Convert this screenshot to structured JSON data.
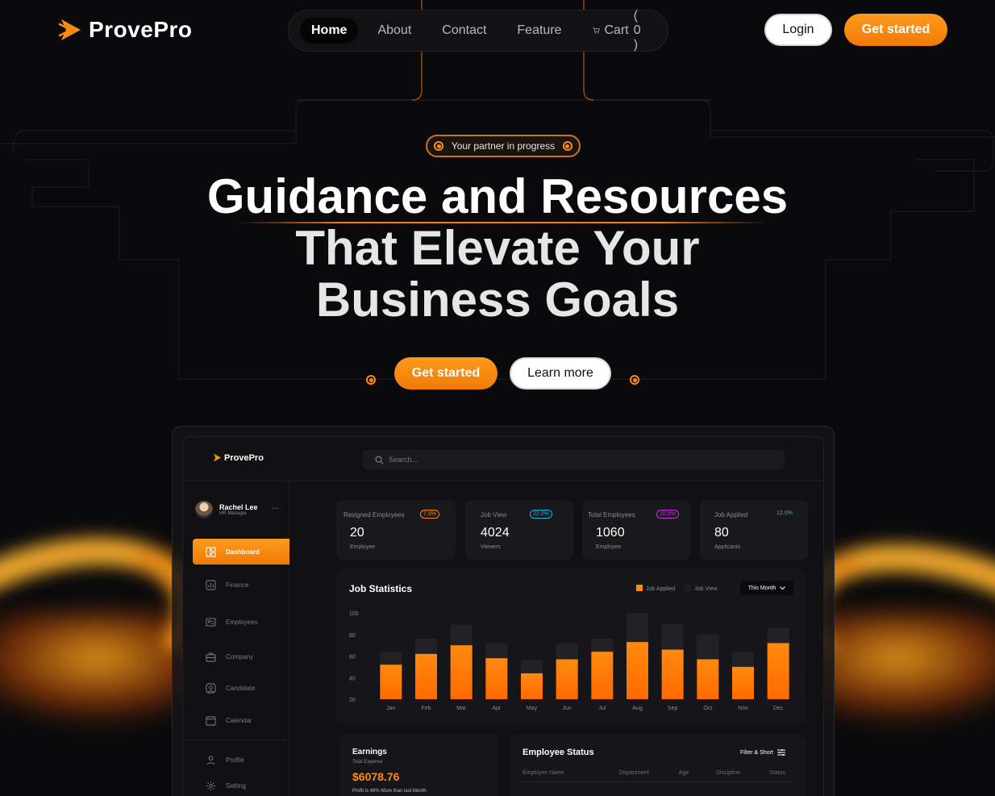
{
  "brand": {
    "name": "ProvePro",
    "accent": "#ff8a10"
  },
  "nav": {
    "items": [
      "Home",
      "About",
      "Contact",
      "Feature"
    ],
    "cart_label": "Cart",
    "cart_count": "( 0 )"
  },
  "header": {
    "login": "Login",
    "get_started": "Get started"
  },
  "hero": {
    "badge": "Your partner in progress",
    "title_line1": "Guidance and Resources",
    "title_line2": "That Elevate Your",
    "title_line3": "Business Goals",
    "cta_primary": "Get started",
    "cta_secondary": "Learn more"
  },
  "dashboard": {
    "logo": "ProvePro",
    "search_placeholder": "Search...",
    "user": {
      "name": "Rachel Lee",
      "role": "HR Manager",
      "more": "..."
    },
    "sidebar": [
      "Dashboard",
      "Finance",
      "Employees",
      "Company",
      "Candidate",
      "Calendar",
      "Profile",
      "Setting"
    ],
    "stats": [
      {
        "label": "Resigned Employees",
        "change": "7.0%",
        "value": "20",
        "unit": "Employee",
        "color": "#ff8a10"
      },
      {
        "label": "Job View",
        "change": "22.0%",
        "value": "4024",
        "unit": "Viewers",
        "color": "#19b6e8"
      },
      {
        "label": "Total Employees",
        "change": "10.0%",
        "value": "1060",
        "unit": "Employee",
        "color": "#c23bd9"
      },
      {
        "label": "Job Applied",
        "change": "12.0%",
        "value": "80",
        "unit": "Applicants",
        "color": "#19b6e8"
      }
    ],
    "job_stats": {
      "title": "Job Statistics",
      "legend_applied": "Job Applied",
      "legend_view": "Job View",
      "period": "This Month"
    },
    "earnings": {
      "title": "Earnings",
      "subtitle": "Total Expense",
      "value": "$6078.76",
      "note": "Profit is 48% More than last Month"
    },
    "employee_status": {
      "title": "Employee Status",
      "filter": "Filter & Short",
      "columns": [
        "Employee Name",
        "Department",
        "Age",
        "Discipline",
        "Status"
      ]
    }
  },
  "chart_data": {
    "type": "bar",
    "title": "Job Statistics",
    "categories": [
      "Jan",
      "Feb",
      "Mar",
      "Apr",
      "May",
      "Jun",
      "Jul",
      "Aug",
      "Sep",
      "Oct",
      "Nov",
      "Dec"
    ],
    "series": [
      {
        "name": "Job Applied",
        "values": [
          52,
          62,
          70,
          58,
          44,
          57,
          64,
          73,
          66,
          57,
          50,
          72
        ],
        "color": "#ff8a10"
      },
      {
        "name": "Job View",
        "values": [
          64,
          76,
          89,
          72,
          56,
          72,
          76,
          100,
          90,
          80,
          64,
          86
        ],
        "color": "#222226"
      }
    ],
    "yticks": [
      100,
      80,
      60,
      40,
      20
    ],
    "ylim": [
      20,
      100
    ],
    "grid": true,
    "legend": "top-right"
  }
}
